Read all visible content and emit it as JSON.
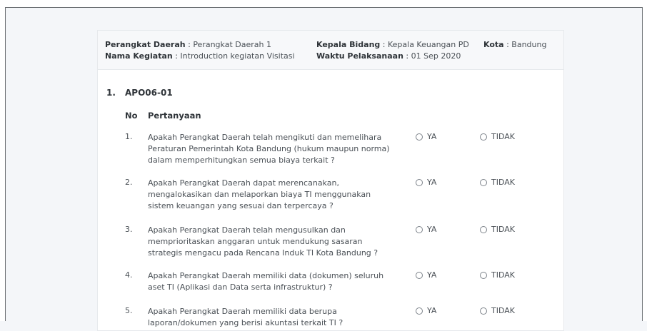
{
  "header": {
    "perangkat_daerah": {
      "label": "Perangkat Daerah",
      "value": "Perangkat Daerah 1"
    },
    "nama_kegiatan": {
      "label": "Nama Kegiatan",
      "value": "Introduction kegiatan Visitasi"
    },
    "kepala_bidang": {
      "label": "Kepala Bidang",
      "value": "Kepala Keuangan PD"
    },
    "waktu_pelaksanaan": {
      "label": "Waktu Pelaksanaan",
      "value": "01 Sep 2020"
    },
    "kota": {
      "label": "Kota",
      "value": "Bandung"
    },
    "separator": " : "
  },
  "section": {
    "number": "1.",
    "title": "APO06-01"
  },
  "table_headers": {
    "no": "No",
    "question": "Pertanyaan"
  },
  "options": {
    "yes": "YA",
    "no": "TIDAK"
  },
  "questions": [
    {
      "no": "1.",
      "text": "Apakah Perangkat Daerah telah mengikuti dan memelihara Peraturan Pemerintah Kota Bandung (hukum maupun norma) dalam memperhitungkan semua biaya terkait ?"
    },
    {
      "no": "2.",
      "text": "Apakah Perangkat Daerah dapat merencanakan, mengalokasikan dan melaporkan biaya TI menggunakan sistem keuangan yang sesuai dan terpercaya ?"
    },
    {
      "no": "3.",
      "text": "Apakah Perangkat Daerah telah mengusulkan dan memprioritaskan anggaran untuk mendukung sasaran strategis mengacu pada Rencana Induk TI Kota Bandung ?"
    },
    {
      "no": "4.",
      "text": "Apakah Perangkat Daerah memiliki data (dokumen) seluruh aset TI (Aplikasi dan Data serta infrastruktur) ?"
    },
    {
      "no": "5.",
      "text": "Apakah Perangkat Daerah memiliki data berupa laporan/dokumen yang berisi akuntasi terkait TI ?"
    }
  ]
}
